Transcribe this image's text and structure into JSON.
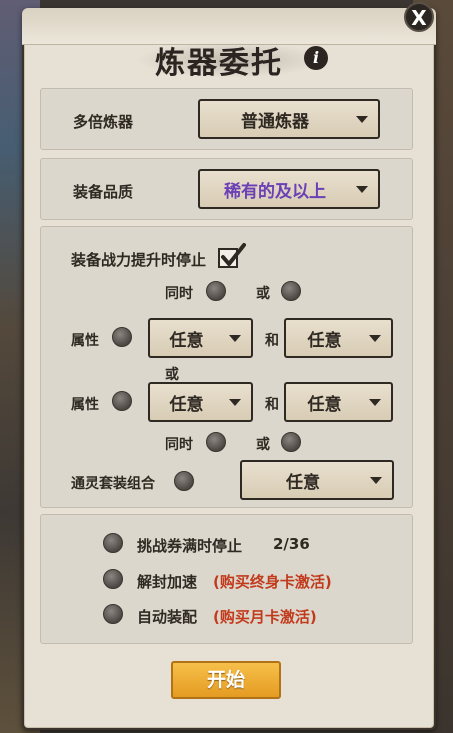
{
  "window": {
    "title": "炼器委托",
    "close_label": "X"
  },
  "multi": {
    "label": "多倍炼器",
    "value": "普通炼器"
  },
  "quality": {
    "label": "装备品质",
    "value": "稀有的及以上",
    "color": "#6b3fb5"
  },
  "stop_section": {
    "stop_on_power_up": "装备战力提升时停止",
    "same_time": "同时",
    "or": "或",
    "attr_label": "属性",
    "and": "和",
    "any": "任意",
    "spirit_set_label": "通灵套装组合"
  },
  "options": {
    "challenge_label": "挑战券满时停止",
    "challenge_count": "2/36",
    "unseal_label": "解封加速",
    "unseal_hint": "(购买终身卡激活)",
    "auto_equip_label": "自动装配",
    "auto_equip_hint": "(购买月卡激活)"
  },
  "start_label": "开始",
  "icons": {
    "info": "i",
    "check": "✔"
  }
}
